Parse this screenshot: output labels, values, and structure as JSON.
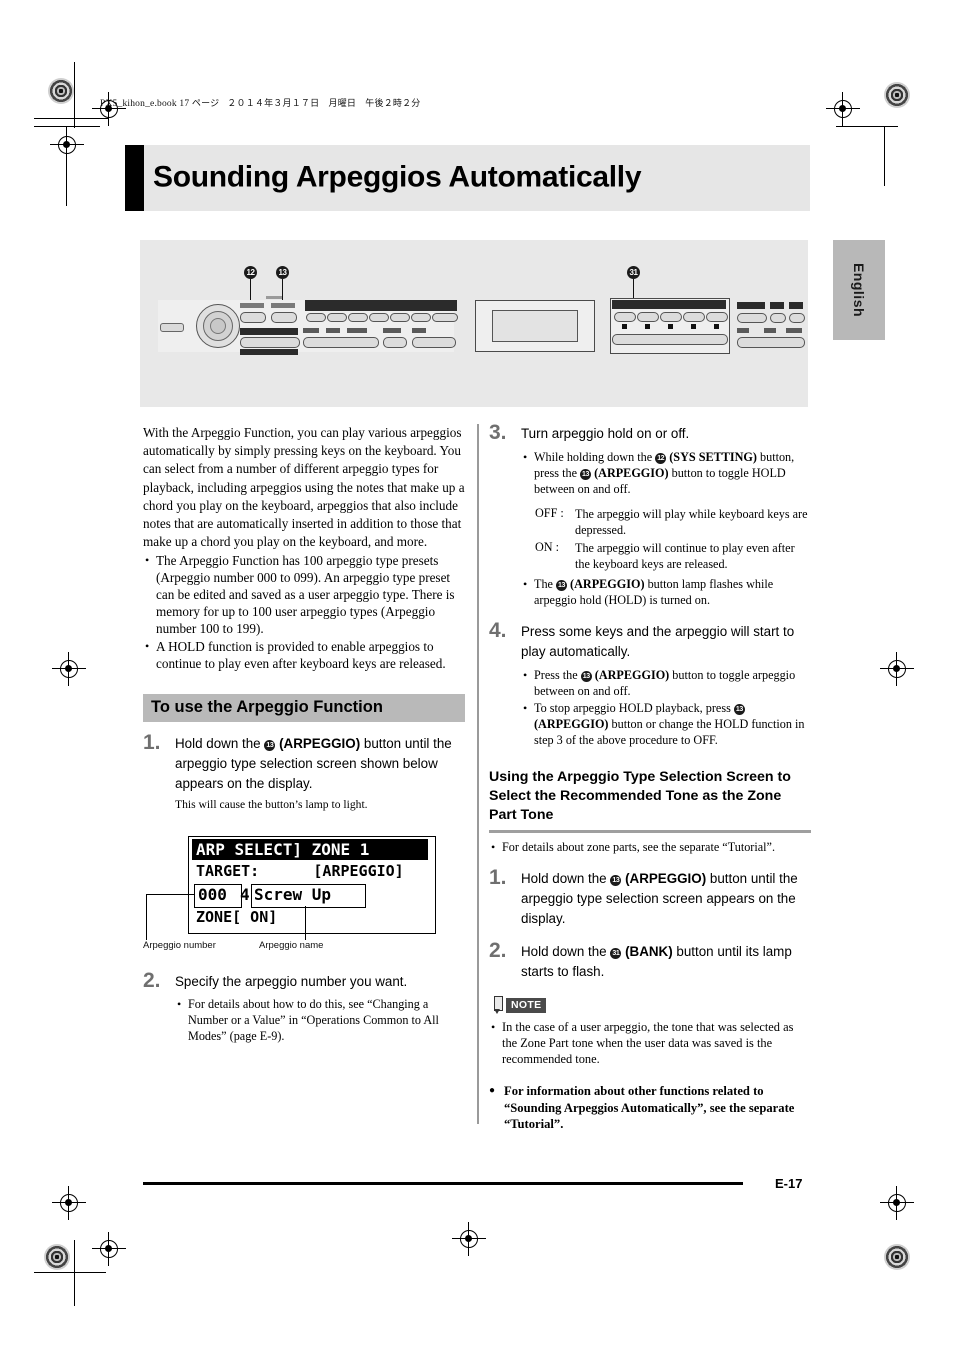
{
  "header": {
    "file_info_latin": "PX5_kihon_e.book   17 ",
    "file_info_page_word": "ページ",
    "file_info_date": "２０１４年３月１７日　月曜日　午後２時２分"
  },
  "title": "Sounding Arpeggios Automatically",
  "side_tab": "English",
  "figure": {
    "callouts": [
      "12",
      "13",
      "31"
    ]
  },
  "left_column": {
    "intro": "With the Arpeggio Function, you can play various arpeggios automatically by simply pressing keys on the keyboard. You can select from a number of different arpeggio types for playback, including arpeggios using the notes that make up a chord you play on the keyboard, arpeggios that also include notes that are automatically inserted in addition to those that make up a chord you play on the keyboard, and more.",
    "bullets": [
      "The Arpeggio Function has 100 arpeggio type presets (Arpeggio number 000 to 099). An arpeggio type preset can be edited and saved as a user arpeggio type. There is memory for up to 100 user arpeggio types (Arpeggio number 100 to 199).",
      "A HOLD function is provided to enable arpeggios to continue to play even after keyboard keys are released."
    ],
    "section_heading": "To use the Arpeggio Function",
    "step1": {
      "num": "1.",
      "badge": "13",
      "text_before": "Hold down the ",
      "text_bold": "(ARPEGGIO)",
      "text_after": " button until the arpeggio type selection screen shown below appears on the display.",
      "sub": "This will cause the button’s lamp to light."
    },
    "lcd": {
      "line1": "ARP SELECT] ZONE 1",
      "line2": "TARGET:      [ARPEGGIO]",
      "line3_number": "000",
      "line3_arrow": "4",
      "line3_name": "Screw Up",
      "line4": "ZONE[ ON]",
      "label_number": "Arpeggio number",
      "label_name": "Arpeggio name"
    },
    "step2": {
      "num": "2.",
      "text": "Specify the arpeggio number you want.",
      "bullets": [
        "For details about how to do this, see “Changing a Number or a Value” in “Operations Common to All Modes” (page E-9)."
      ]
    }
  },
  "right_column": {
    "step3": {
      "num": "3.",
      "text": "Turn arpeggio hold on or off.",
      "bullet1_before": "While holding down the ",
      "bullet1_badge1": "12",
      "bullet1_bold1": "(SYS SETTING)",
      "bullet1_mid": " button, press the ",
      "bullet1_badge2": "13",
      "bullet1_bold2": "(ARPEGGIO)",
      "bullet1_after": " button to toggle HOLD between on and off.",
      "off_label": "OFF :",
      "off_text": "The arpeggio will play while keyboard keys are depressed.",
      "on_label": "ON  :",
      "on_text": "The arpeggio will continue to play even after the keyboard keys are released.",
      "bullet2_before": "The ",
      "bullet2_badge": "13",
      "bullet2_bold": "(ARPEGGIO)",
      "bullet2_after": " button lamp flashes while arpeggio hold (HOLD) is turned on."
    },
    "step4": {
      "num": "4.",
      "text": "Press some keys and the arpeggio will start to play automatically.",
      "bullet1_before": "Press the ",
      "bullet1_badge": "13",
      "bullet1_bold": "(ARPEGGIO)",
      "bullet1_after": " button to toggle arpeggio between on and off.",
      "bullet2_before": "To stop arpeggio HOLD playback, press ",
      "bullet2_badge": "13",
      "bullet2_bold": "(ARPEGGIO)",
      "bullet2_after": " button or change the HOLD function in step 3 of the above procedure to OFF."
    },
    "subheading": "Using the Arpeggio Type Selection Screen to Select the Recommended Tone as the Zone Part Tone",
    "subheading_bullet": "For details about zone parts, see the separate “Tutorial”.",
    "sub_step1": {
      "num": "1.",
      "before": "Hold down the ",
      "badge": "13",
      "bold": "(ARPEGGIO)",
      "after": " button until the arpeggio type selection screen appears on the display."
    },
    "sub_step2": {
      "num": "2.",
      "before": "Hold down the ",
      "badge": "31",
      "bold": "(BANK)",
      "after": " button until its lamp starts to flash."
    },
    "note": {
      "badge": "NOTE",
      "bullets": [
        "In the case of a user arpeggio, the tone that was selected as the Zone Part tone when the user data was saved is the recommended tone."
      ]
    },
    "final_bullet": "For information about other functions related to “Sounding Arpeggios Automatically”, see the separate “Tutorial”."
  },
  "footer": {
    "page_number": "E-17"
  },
  "colors": {
    "title_band": "#e6e6e6",
    "section_heading": "#b9b9b9",
    "side_tab": "#b8b8b8",
    "step_number": "#6f6f6f",
    "figure_bg": "#e8e8e8"
  }
}
